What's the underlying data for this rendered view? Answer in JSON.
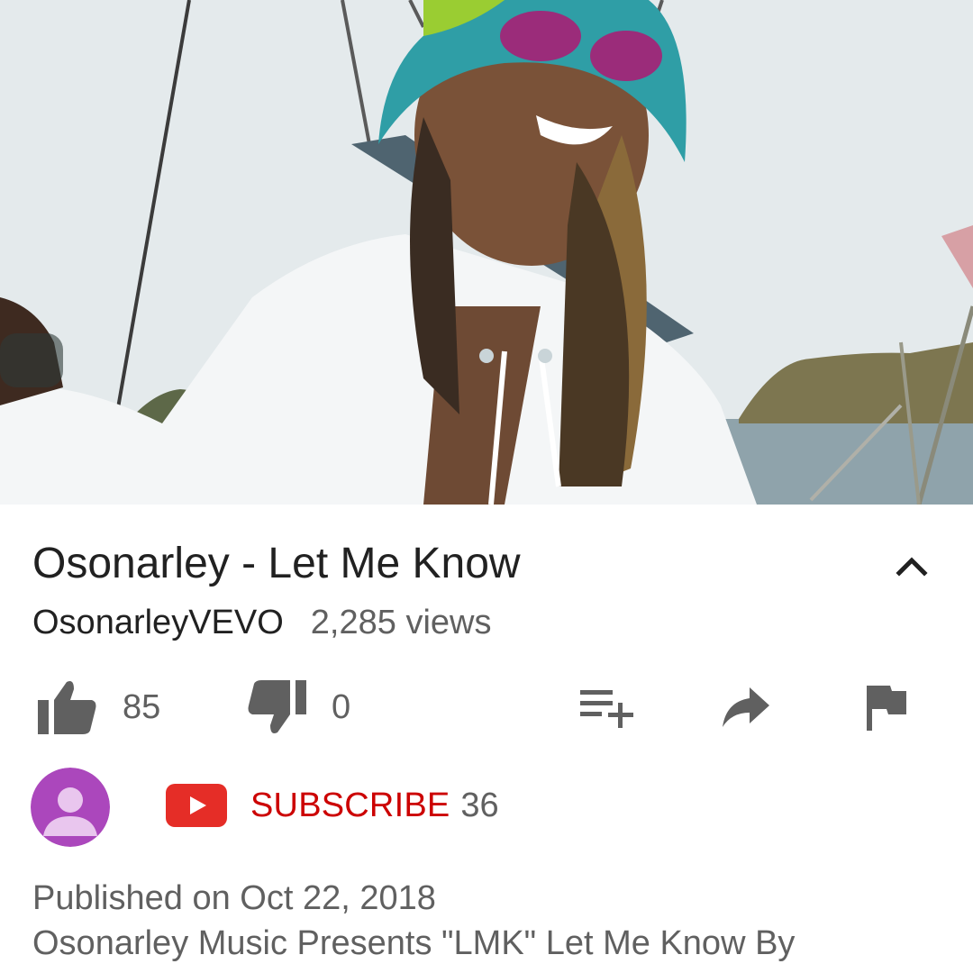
{
  "video": {
    "title": "Osonarley - Let Me Know",
    "channel": "OsonarleyVEVO",
    "views": "2,285 views"
  },
  "actions": {
    "likes": "85",
    "dislikes": "0"
  },
  "subscription": {
    "label": "SUBSCRIBE",
    "count": "36"
  },
  "description": {
    "published": "Published on Oct 22, 2018",
    "text": "Osonarley Music Presents \"LMK\" Let Me Know By"
  },
  "icons": {
    "collapse": "chevron-up-icon",
    "like": "thumb-up-icon",
    "dislike": "thumb-down-icon",
    "add_to_playlist": "playlist-add-icon",
    "share": "share-icon",
    "report": "flag-icon",
    "youtube": "youtube-logo-icon",
    "avatar": "default-avatar-icon"
  },
  "colors": {
    "subscribe": "#cc0000",
    "avatar_bg": "#ab47bc",
    "icon": "#606060"
  }
}
